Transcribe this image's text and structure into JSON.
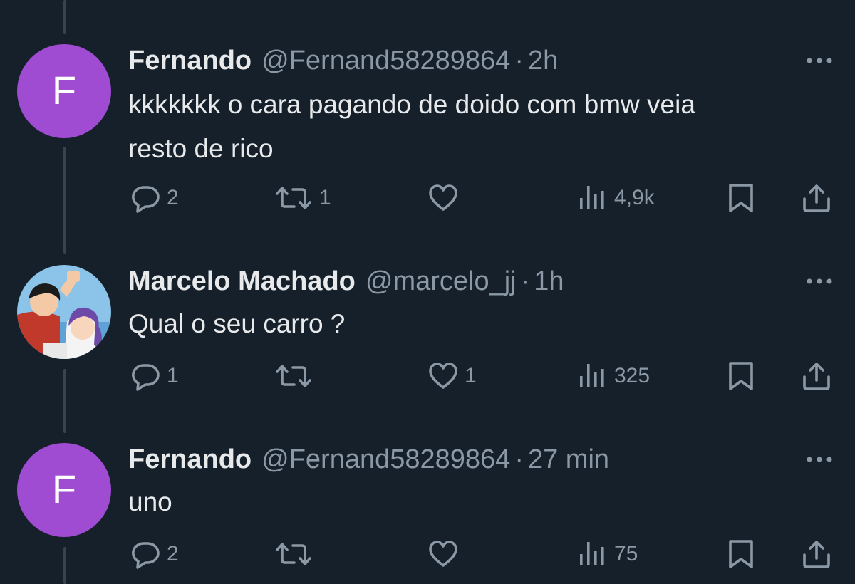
{
  "tweets": [
    {
      "avatar_letter": "F",
      "name": "Fernando",
      "handle": "@Fernand58289864",
      "separator": "·",
      "time": "2h",
      "text": [
        "kkkkkkk o cara pagando de doido com bmw veia",
        "resto de rico"
      ],
      "replies": "2",
      "retweets": "1",
      "likes": "",
      "views": "4,9k"
    },
    {
      "avatar_letter": "",
      "name": "Marcelo Machado",
      "handle": "@marcelo_jj",
      "separator": "·",
      "time": "1h",
      "text": [
        "Qual o seu carro ?"
      ],
      "replies": "1",
      "retweets": "",
      "likes": "1",
      "views": "325"
    },
    {
      "avatar_letter": "F",
      "name": "Fernando",
      "handle": "@Fernand58289864",
      "separator": "·",
      "time": "27 min",
      "text": [
        "uno"
      ],
      "replies": "2",
      "retweets": "",
      "likes": "",
      "views": "75"
    }
  ],
  "icons": {
    "reply": "reply-icon",
    "retweet": "retweet-icon",
    "like": "heart-icon",
    "views": "views-icon",
    "bookmark": "bookmark-icon",
    "share": "share-icon",
    "more": "more-icon"
  },
  "colors": {
    "background": "#15202b",
    "primary_text": "#e7e9ea",
    "secondary_text": "#8b98a5",
    "avatar_purple": "#a04cd2",
    "thread_line": "#38444d"
  }
}
